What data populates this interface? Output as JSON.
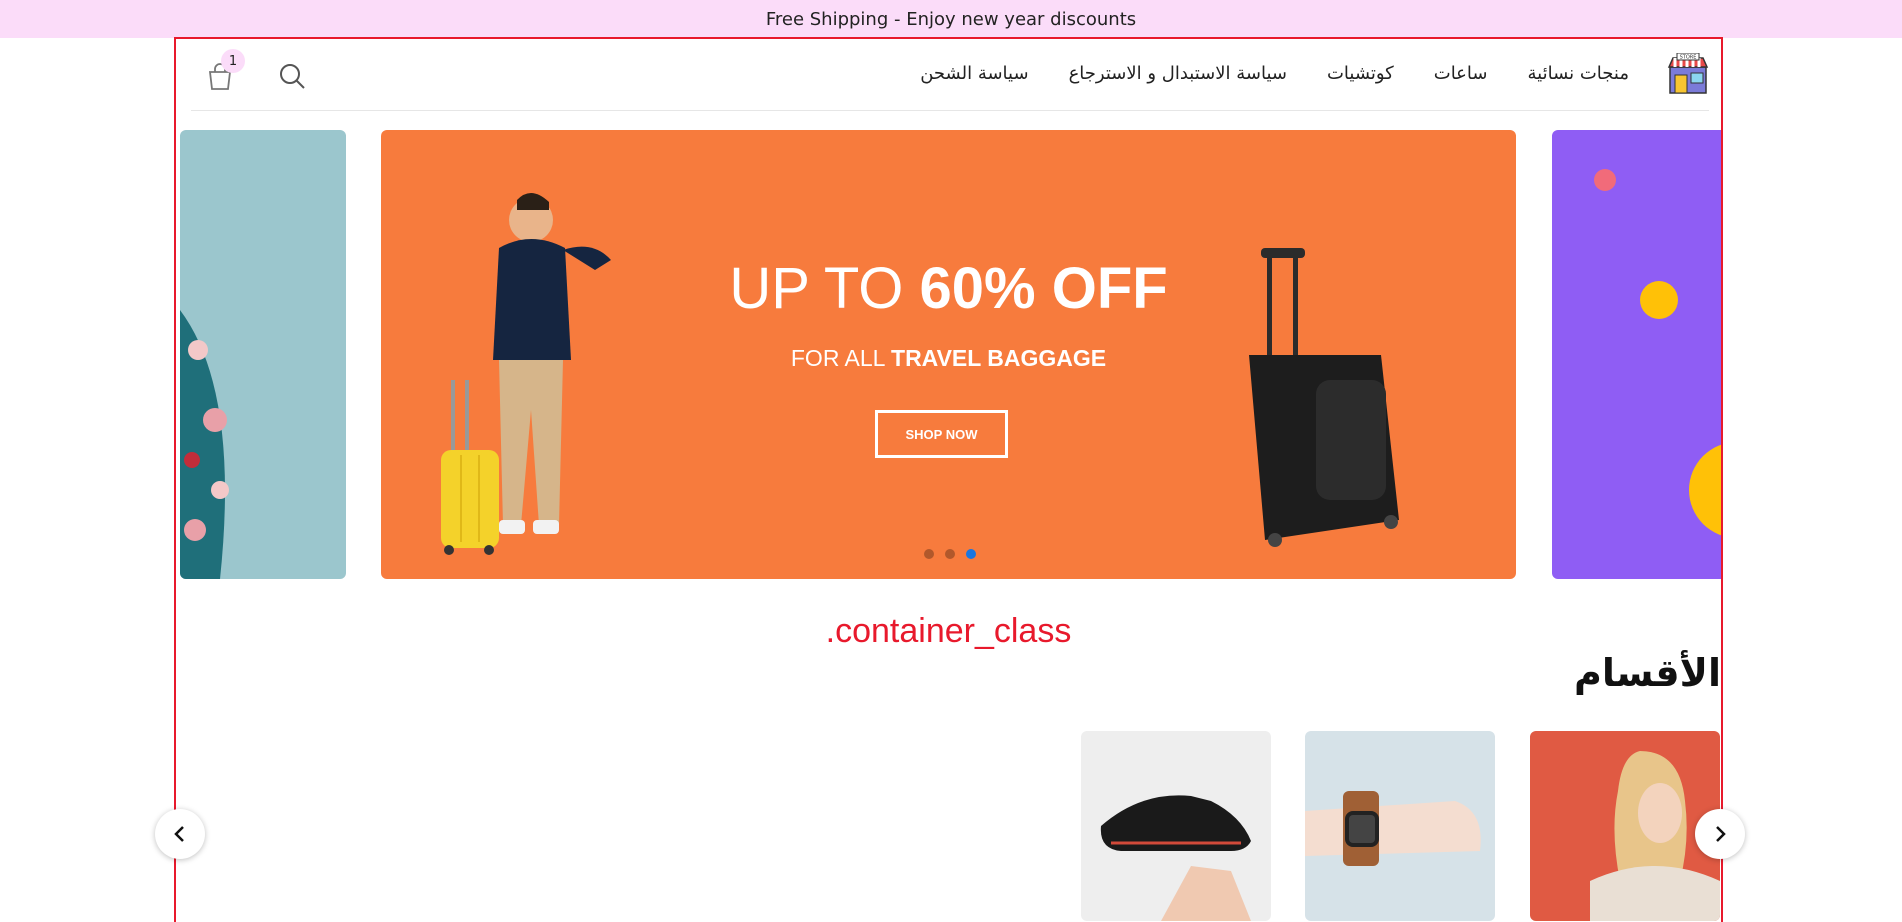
{
  "announcement": "Free Shipping - Enjoy new year discounts",
  "header": {
    "nav": [
      "منجات نسائية",
      "ساعات",
      "كوتشيات",
      "سياسة الاستبدال و الاسترجاع",
      "سياسة الشحن"
    ],
    "cart_count": "1",
    "logo_text": "STORE"
  },
  "hero": {
    "title_light": "UP TO ",
    "title_bold": "60% OFF",
    "subtitle_light": "FOR ALL ",
    "subtitle_bold": "TRAVEL BAGGAGE",
    "button": "SHOP NOW",
    "slide_count": 3,
    "active_slide": 3
  },
  "container_label": ".container_class",
  "categories": {
    "title": "الأقسام",
    "items": [
      "women",
      "watch",
      "sneaker"
    ]
  },
  "colors": {
    "topbar": "#fbdcf9",
    "frame": "#e8192c",
    "hero_bg": "#f77b3d",
    "purple_slide": "#8f5df4",
    "teal_slide": "#9bc6cd"
  }
}
